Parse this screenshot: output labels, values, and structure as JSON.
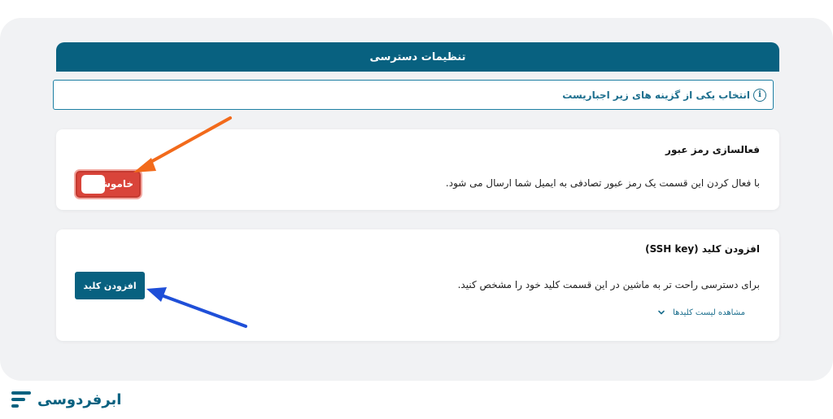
{
  "header": {
    "title": "تنظیمات دسترسی"
  },
  "notice": {
    "text": "انتخاب یکی از گزینه های زیر اجباریست",
    "icon": "info-icon"
  },
  "password_card": {
    "title": "فعالسازی رمز عبور",
    "description": "با فعال کردن این قسمت یک رمز عبور تصادفی به ایمیل شما ارسال می شود.",
    "toggle": {
      "label": "خاموش",
      "state": "off",
      "color": "#d9443a"
    }
  },
  "ssh_card": {
    "title": "افزودن کلید (SSH key)",
    "description": "برای دسترسی راحت تر به ماشین در این قسمت کلید خود را مشخص کنید.",
    "add_button_label": "افزودن کلید",
    "view_keys_label": "مشاهده لیست کلیدها"
  },
  "brand": {
    "name": "ابرفردوسی",
    "color": "#086180"
  },
  "annotations": {
    "arrow_toggle_color": "#f26a1b",
    "arrow_button_color": "#1f4fd8"
  }
}
